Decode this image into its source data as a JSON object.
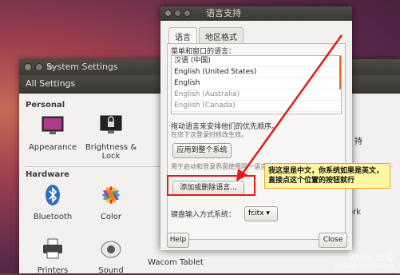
{
  "system_settings": {
    "title": "System Settings",
    "toolbar_label": "All Settings",
    "sections": {
      "personal": "Personal",
      "hardware": "Hardware"
    },
    "items": {
      "appearance": "Appearance",
      "brightness": "Brightness &\nLock",
      "bluetooth": "Bluetooth",
      "color": "Color",
      "printers": "Printers",
      "sound": "Sound",
      "wacom": "Wacom Tablet",
      "partial_right1": "持",
      "partial_right2": "ork"
    }
  },
  "dialog": {
    "title": "语言支持",
    "tabs": [
      "语言",
      "地区格式"
    ],
    "menu_lang_label": "菜单和窗口的语言：",
    "languages": [
      {
        "name": "汉语 (中国)",
        "faded": false
      },
      {
        "name": "English (United States)",
        "faded": false
      },
      {
        "name": "English",
        "faded": false
      },
      {
        "name": "English (Australia)",
        "faded": true
      },
      {
        "name": "English (Canada)",
        "faded": true
      }
    ],
    "drag_hint": "拖动语言来安排他们的优先顺序。",
    "drag_hint_sub": "在您下次登录时修改生效。",
    "apply_system_btn": "应用到整个系统",
    "login_hint": "用于启动和登录界面使用同一语言。",
    "add_remove_btn": "添加或删除语言...",
    "input_method_label": "键盘输入方式系统：",
    "input_method_value": "fcitx",
    "help_btn": "Help",
    "close_btn": "Close"
  },
  "annotation": {
    "callout_text": "我这里是中文，你系统如果是英文，直接点这个位置的按钮就行",
    "arrow_color": "#e31b1b"
  },
  "watermark": {
    "brand": "Baidu 经验",
    "url": "jingyan.baidu.com"
  }
}
